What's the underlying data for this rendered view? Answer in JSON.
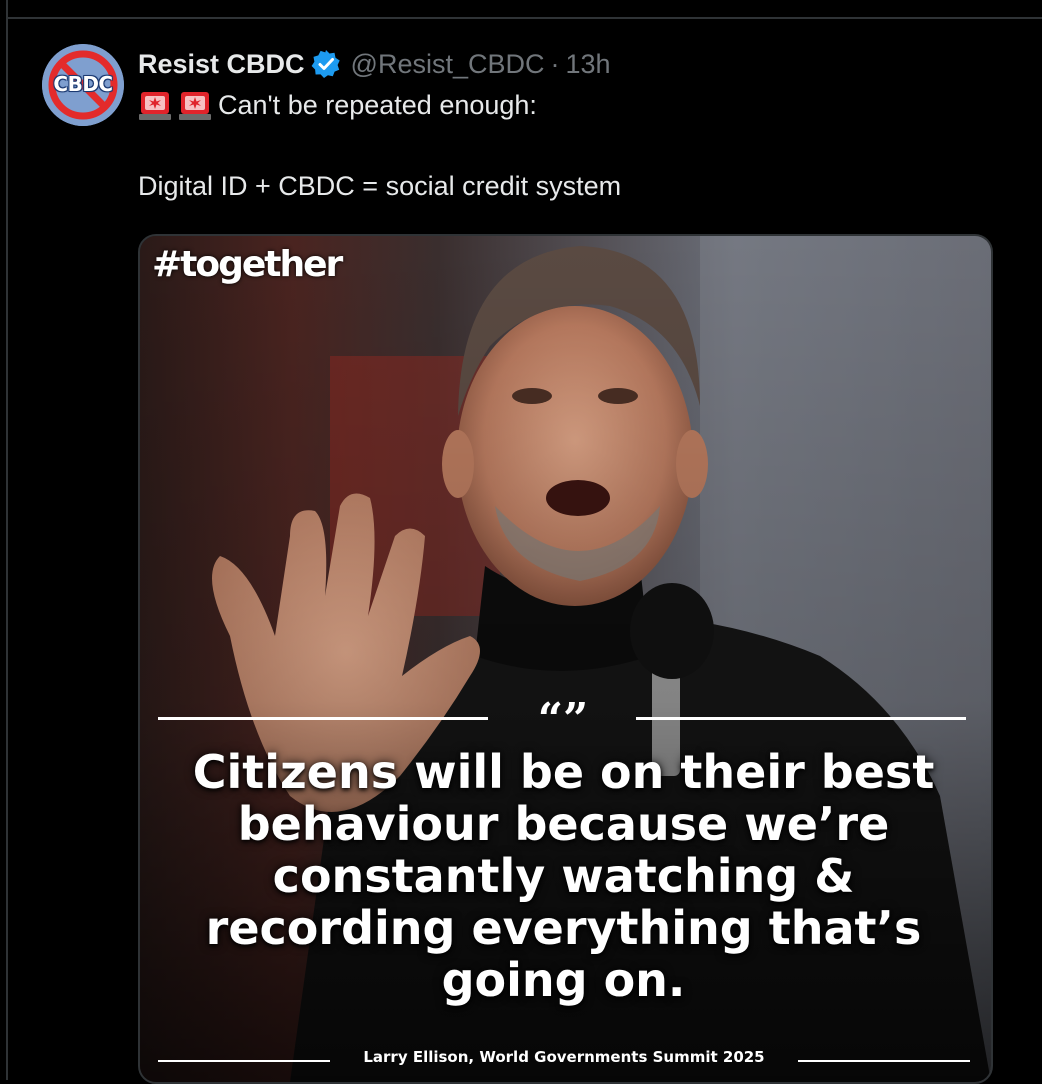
{
  "post": {
    "author_name": "Resist CBDC",
    "handle": "@Resist_CBDC",
    "separator": "·",
    "time": "13h",
    "avatar_text": "CBDC",
    "verified_icon": "verified-badge-icon",
    "text_line1": "Can't be repeated enough:",
    "text_line2": "Digital ID + CBDC = social credit system",
    "emoji": [
      "police-siren-icon",
      "police-siren-icon"
    ]
  },
  "media": {
    "hashtag": "#together",
    "quote_mark": "“”",
    "quote_lines": [
      "Citizens will be on their best",
      "behaviour because we’re",
      "constantly watching &",
      "recording everything that’s",
      "going on."
    ],
    "attribution": "Larry Ellison, World Governments Summit 2025"
  },
  "colors": {
    "background": "#000000",
    "text_primary": "#e7e9ea",
    "text_secondary": "#71767b",
    "verified_blue": "#1d9bf0",
    "border": "#2f3336",
    "siren_red": "#e0242b"
  }
}
